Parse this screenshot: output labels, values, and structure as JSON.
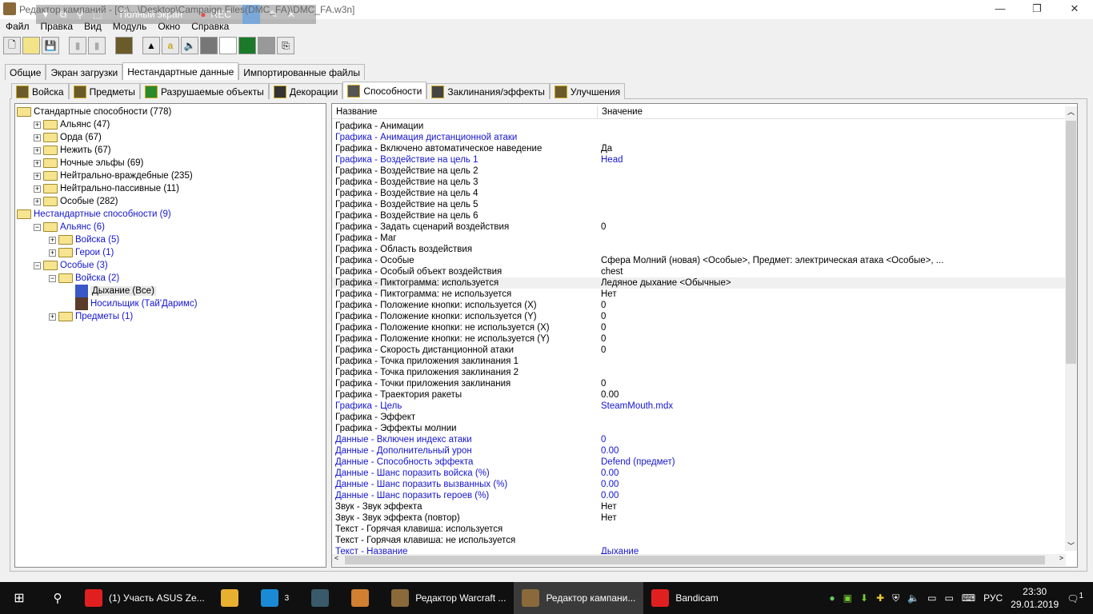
{
  "window": {
    "title": "Редактор кампаний - [C:\\...\\Desktop\\Campaign Files(DMC_FA)\\DMC_FA.w3n]",
    "minimize": "—",
    "maximize": "❐",
    "close": "✕"
  },
  "recorder": {
    "fullscreen": "Полный экран",
    "rec": "REC"
  },
  "menu": [
    "Файл",
    "Правка",
    "Вид",
    "Модуль",
    "Окно",
    "Справка"
  ],
  "toolbar": [
    "new",
    "open",
    "save",
    "copy",
    "paste",
    "abilities",
    "terrain",
    "text",
    "sound",
    "units",
    "campaign",
    "ai",
    "object",
    "import"
  ],
  "main_tabs": [
    {
      "label": "Общие"
    },
    {
      "label": "Экран загрузки"
    },
    {
      "label": "Нестандартные данные",
      "active": true
    },
    {
      "label": "Импортированные файлы"
    }
  ],
  "data_tabs": [
    {
      "label": "Войска"
    },
    {
      "label": "Предметы"
    },
    {
      "label": "Разрушаемые объекты"
    },
    {
      "label": "Декорации"
    },
    {
      "label": "Способности",
      "active": true
    },
    {
      "label": "Заклинания/эффекты"
    },
    {
      "label": "Улучшения"
    }
  ],
  "tree": [
    {
      "label": "Стандартные способности (778)",
      "level": 0,
      "type": "open"
    },
    {
      "label": "Альянс (47)",
      "level": 1,
      "type": "plus"
    },
    {
      "label": "Орда (67)",
      "level": 1,
      "type": "plus"
    },
    {
      "label": "Нежить (67)",
      "level": 1,
      "type": "plus"
    },
    {
      "label": "Ночные эльфы (69)",
      "level": 1,
      "type": "plus"
    },
    {
      "label": "Нейтрально-враждебные (235)",
      "level": 1,
      "type": "plus"
    },
    {
      "label": "Нейтрально-пассивные (11)",
      "level": 1,
      "type": "plus"
    },
    {
      "label": "Особые (282)",
      "level": 1,
      "type": "plus"
    },
    {
      "label": "Нестандартные способности (9)",
      "level": 0,
      "type": "open",
      "blue": true
    },
    {
      "label": "Альянс (6)",
      "level": 1,
      "type": "minus",
      "blue": true
    },
    {
      "label": "Войска (5)",
      "level": 2,
      "type": "plus",
      "blue": true
    },
    {
      "label": "Герои (1)",
      "level": 2,
      "type": "plus",
      "blue": true
    },
    {
      "label": "Особые (3)",
      "level": 1,
      "type": "minus",
      "blue": true
    },
    {
      "label": "Войска (2)",
      "level": 2,
      "type": "minus",
      "blue": true
    },
    {
      "label": "Дыхание (Все)",
      "level": 3,
      "type": "leaf",
      "selected": true
    },
    {
      "label": "Носильщик (Тай'Даримс)",
      "level": 3,
      "type": "leaf",
      "blue": true
    },
    {
      "label": "Предметы (1)",
      "level": 2,
      "type": "plus",
      "blue": true
    }
  ],
  "list": {
    "col_name": "Название",
    "col_value": "Значение",
    "rows": [
      {
        "n": "Графика - Анимации",
        "v": ""
      },
      {
        "n": "Графика - Анимация дистанционной атаки",
        "v": "",
        "blue": true
      },
      {
        "n": "Графика - Включено автоматическое наведение",
        "v": "Да"
      },
      {
        "n": "Графика - Воздействие на цель 1",
        "v": "Head",
        "blue": true
      },
      {
        "n": "Графика - Воздействие на цель 2",
        "v": ""
      },
      {
        "n": "Графика - Воздействие на цель 3",
        "v": ""
      },
      {
        "n": "Графика - Воздействие на цель 4",
        "v": ""
      },
      {
        "n": "Графика - Воздействие на цель 5",
        "v": ""
      },
      {
        "n": "Графика - Воздействие на цель 6",
        "v": ""
      },
      {
        "n": "Графика - Задать сценарий воздействия",
        "v": "0"
      },
      {
        "n": "Графика - Маг",
        "v": ""
      },
      {
        "n": "Графика - Область воздействия",
        "v": ""
      },
      {
        "n": "Графика - Особые",
        "v": "Сфера Молний (новая) <Особые>, Предмет: электрическая атака <Особые>, ..."
      },
      {
        "n": "Графика - Особый объект воздействия",
        "v": "chest"
      },
      {
        "n": "Графика - Пиктограмма: используется",
        "v": "Ледяное дыхание <Обычные>",
        "hl": true
      },
      {
        "n": "Графика - Пиктограмма: не используется",
        "v": "Нет"
      },
      {
        "n": "Графика - Положение кнопки: используется (X)",
        "v": "0"
      },
      {
        "n": "Графика - Положение кнопки: используется (Y)",
        "v": "0"
      },
      {
        "n": "Графика - Положение кнопки: не используется (X)",
        "v": "0"
      },
      {
        "n": "Графика - Положение кнопки: не используется (Y)",
        "v": "0"
      },
      {
        "n": "Графика - Скорость дистанционной атаки",
        "v": "0"
      },
      {
        "n": "Графика - Точка приложения заклинания 1",
        "v": ""
      },
      {
        "n": "Графика - Точка приложения заклинания 2",
        "v": ""
      },
      {
        "n": "Графика - Точки приложения заклинания",
        "v": "0"
      },
      {
        "n": "Графика - Траектория ракеты",
        "v": "0.00"
      },
      {
        "n": "Графика - Цель",
        "v": "SteamMouth.mdx",
        "blue": true
      },
      {
        "n": "Графика - Эффект",
        "v": ""
      },
      {
        "n": "Графика - Эффекты молнии",
        "v": ""
      },
      {
        "n": "Данные - Включен индекс атаки",
        "v": "0",
        "blue": true
      },
      {
        "n": "Данные - Дополнительный урон",
        "v": "0.00",
        "blue": true
      },
      {
        "n": "Данные - Способность эффекта",
        "v": "Defend (предмет)",
        "blue": true
      },
      {
        "n": "Данные - Шанс поразить войска (%)",
        "v": "0.00",
        "blue": true
      },
      {
        "n": "Данные - Шанс поразить вызванных (%)",
        "v": "0.00",
        "blue": true
      },
      {
        "n": "Данные - Шанс поразить героев (%)",
        "v": "0.00",
        "blue": true
      },
      {
        "n": "Звук - Звук эффекта",
        "v": "Нет"
      },
      {
        "n": "Звук - Звук эффекта (повтор)",
        "v": "Нет"
      },
      {
        "n": "Текст - Горячая клавиша: используется",
        "v": ""
      },
      {
        "n": "Текст - Горячая клавиша: не используется",
        "v": ""
      },
      {
        "n": "Текст - Название",
        "v": "Дыхание",
        "blue": true
      }
    ]
  },
  "taskbar": {
    "items": [
      {
        "label": "(1) Участь ASUS Ze...",
        "color": "#e02020"
      },
      {
        "label": "",
        "color": "#e8b030"
      },
      {
        "label": "",
        "color": "#1a8ad4",
        "badge": "3"
      },
      {
        "label": "",
        "color": "#3a5a6a"
      },
      {
        "label": "",
        "color": "#d08030"
      },
      {
        "label": "Редактор Warcraft ...",
        "color": "#8a6a3a"
      },
      {
        "label": "Редактор кампани...",
        "color": "#8a6a3a",
        "active": true
      },
      {
        "label": "Bandicam",
        "color": "#e02020"
      }
    ],
    "lang": "РУС",
    "time": "23:30",
    "date": "29.01.2019",
    "notifications": "1"
  }
}
